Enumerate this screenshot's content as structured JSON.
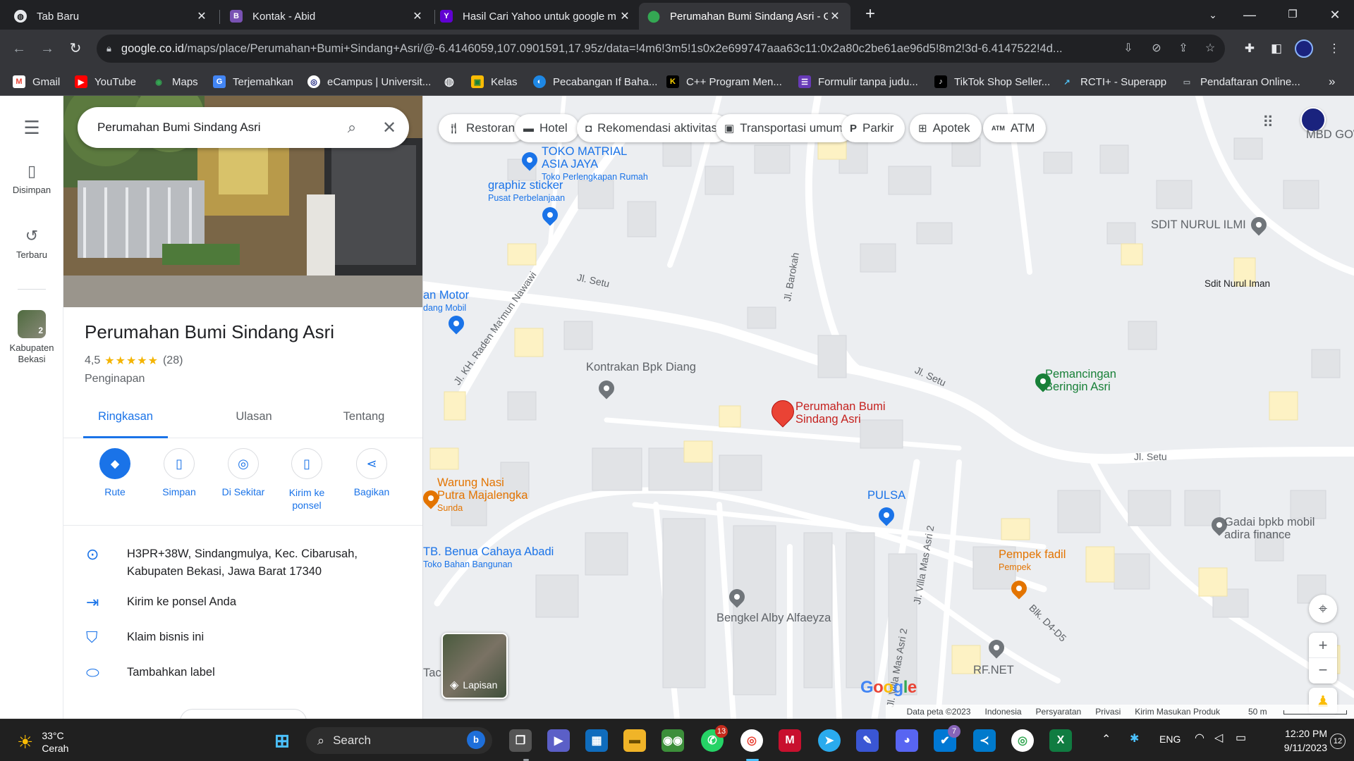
{
  "browser": {
    "tabs": [
      {
        "title": "Tab Baru",
        "active": false
      },
      {
        "title": "Kontak - Abid",
        "active": false
      },
      {
        "title": "Hasil Cari Yahoo untuk google m",
        "active": false
      },
      {
        "title": "Perumahan Bumi Sindang Asri - G",
        "active": true
      }
    ],
    "url_host": "google.co.id",
    "url_path": "/maps/place/Perumahan+Bumi+Sindang+Asri/@-6.4146059,107.0901591,17.95z/data=!4m6!3m5!1s0x2e699747aaa63c11:0x2a80c2be61ae96d5!8m2!3d-6.4147522!4d...",
    "bookmarks": [
      "Gmail",
      "YouTube",
      "Maps",
      "Terjemahkan",
      "eCampus | Universit...",
      "",
      "Kelas",
      "Pecabangan If Baha...",
      "C++ Program Men...",
      "Formulir tanpa judu...",
      "TikTok Shop Seller...",
      "RCTI+ - Superapp",
      "Pendaftaran Online..."
    ]
  },
  "rail": {
    "saved": "Disimpan",
    "recent": "Terbaru",
    "recent_place": "Kabupaten Bekasi",
    "recent_count": "2"
  },
  "panel": {
    "search_query": "Perumahan Bumi Sindang Asri",
    "place_name": "Perumahan Bumi Sindang Asri",
    "rating": "4,5",
    "stars": "★★★★★",
    "review_count": "(28)",
    "category": "Penginapan",
    "tabs": [
      "Ringkasan",
      "Ulasan",
      "Tentang"
    ],
    "actions": [
      "Rute",
      "Simpan",
      "Di Sekitar",
      "Kirim ke ponsel",
      "Bagikan"
    ],
    "address_line1": "H3PR+38W, Sindangmulya, Kec. Cibarusah,",
    "address_line2": "Kabupaten Bekasi, Jawa Barat 17340",
    "send_to_phone": "Kirim ke ponsel Anda",
    "claim": "Klaim bisnis ini",
    "add_label": "Tambahkan label"
  },
  "map": {
    "chips": [
      "Restoran",
      "Hotel",
      "Rekomendasi aktivitas",
      "Transportasi umum",
      "Parkir",
      "Apotek",
      "ATM"
    ],
    "selected_place": "Perumahan Bumi Sindang Asri",
    "pois": {
      "toko_material_1": "TOKO MATRIAL",
      "toko_material_2": "ASIA JAYA",
      "toko_material_sub": "Toko Perlengkapan Rumah",
      "graphiz": "graphiz sticker",
      "graphiz_sub": "Pusat Perbelanjaan",
      "motor": "an Motor",
      "motor_sub": "dang Mobil",
      "kontrakan": "Kontrakan Bpk Diang",
      "sdit": "SDIT NURUL ILMI",
      "sdit2": "Sdit Nurul Iman",
      "pemancingan_1": "Pemancingan",
      "pemancingan_2": "Beringin Asri",
      "warung_1": "Warung Nasi",
      "warung_2": "Putra Majalengka",
      "warung_sub": "Sunda",
      "benua": "TB. Benua Cahaya Abadi",
      "benua_sub": "Toko Bahan Bangunan",
      "pulsa": "PULSA",
      "gadai_1": "Gadai bpkb mobil",
      "gadai_2": "adira finance",
      "pempek": "Pempek fadil",
      "pempek_sub": "Pempek",
      "bengkel": "Bengkel Alby Alfaeyza",
      "rfnet": "RF.NET",
      "mbd": "MBD GOW",
      "tac": "Tac"
    },
    "streets": [
      "Jl. Setu",
      "Jl. KH. Raden Ma'mun Nawawi",
      "Jl. Barokah",
      "Jl. Setu",
      "Jl. Setu",
      "Jl. Villa Mas Asri 2",
      "Jl. Villa Mas Asri 2",
      "Blk. D4-D5"
    ],
    "layers_label": "Lapisan",
    "google": "Google",
    "attribution": [
      "Data peta ©2023",
      "Indonesia",
      "Persyaratan",
      "Privasi",
      "Kirim Masukan Produk",
      "50 m"
    ]
  },
  "taskbar": {
    "weather_temp": "33°C",
    "weather_desc": "Cerah",
    "search": "Search",
    "whatsapp_badge": "13",
    "teams_badge": "7",
    "lang": "ENG",
    "time": "12:20 PM",
    "date": "9/11/2023",
    "notif": "12"
  },
  "colors": {
    "accent": "#1a73e8",
    "pin_red": "#ea4335",
    "poi_blue": "#1a73e8",
    "poi_green": "#188038",
    "poi_orange": "#e37400"
  }
}
